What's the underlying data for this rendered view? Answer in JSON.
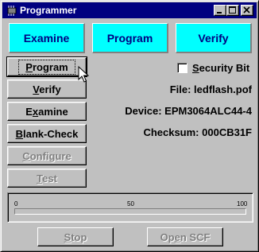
{
  "window": {
    "title": "Programmer",
    "app_icon": "programmer-chip-icon",
    "controls": [
      "minimize-icon",
      "maximize-icon",
      "close-icon"
    ]
  },
  "modes": {
    "examine": "Examine",
    "program": "Program",
    "verify": "Verify",
    "color": "#00ffff",
    "text_color": "#000080"
  },
  "buttons": {
    "program": {
      "pre": "",
      "key": "P",
      "post": "rogram",
      "enabled": true
    },
    "verify": {
      "pre": "",
      "key": "V",
      "post": "erify",
      "enabled": true
    },
    "examine": {
      "pre": "E",
      "key": "x",
      "post": "amine",
      "enabled": true
    },
    "blank_check": {
      "pre": "",
      "key": "B",
      "post": "lank-Check",
      "enabled": true
    },
    "configure": {
      "pre": "",
      "key": "C",
      "post": "onfigure",
      "enabled": false
    },
    "test": {
      "pre": "",
      "key": "T",
      "post": "est",
      "enabled": false
    }
  },
  "security_bit": {
    "pre": "",
    "key": "S",
    "post": "ecurity Bit",
    "checked": false
  },
  "info": {
    "file": "File: ledflash.pof",
    "device": "Device: EPM3064ALC44-4",
    "checksum": "Checksum: 000CB31F"
  },
  "progress": {
    "value": 0,
    "ticks": [
      "0",
      "50",
      "100"
    ],
    "fill_color": "#000080"
  },
  "bottom_buttons": {
    "stop": {
      "pre": "",
      "key": "S",
      "post": "top",
      "enabled": false
    },
    "open_scf": {
      "pre": "Op",
      "key": "e",
      "post": "n SCF",
      "enabled": false
    }
  },
  "cursor": "mouse-pointer-icon"
}
